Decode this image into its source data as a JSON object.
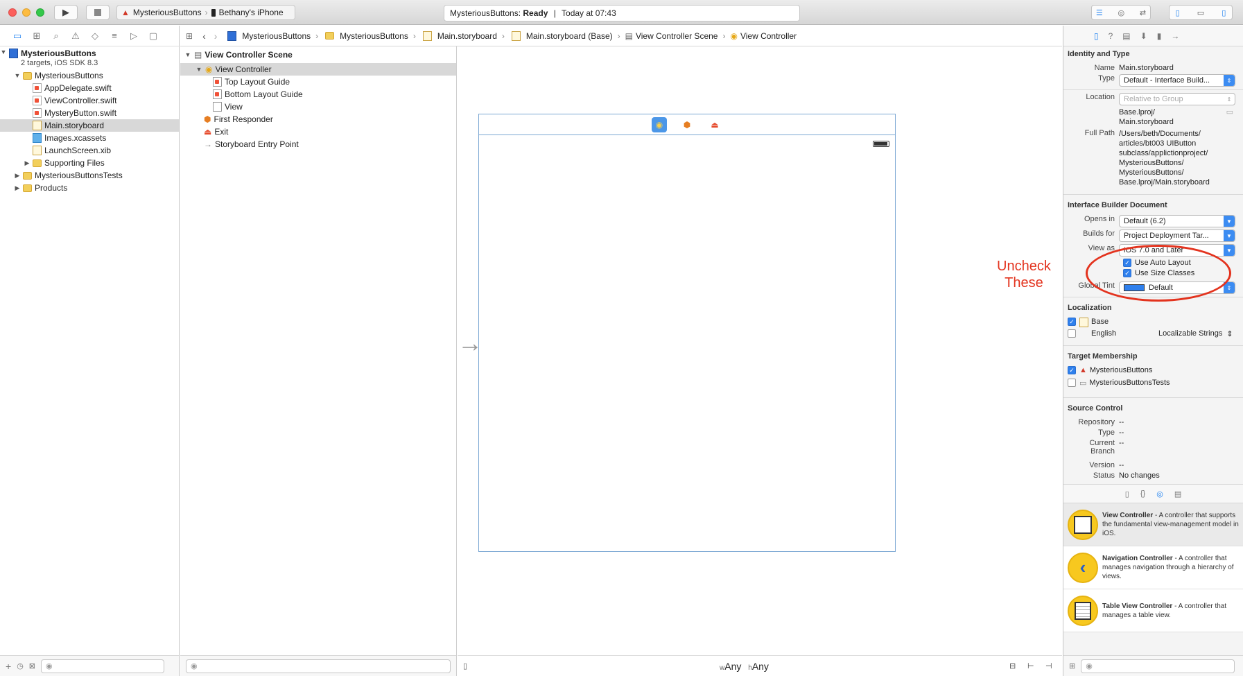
{
  "scheme": {
    "project": "MysteriousButtons",
    "device": "Bethany's iPhone"
  },
  "status": {
    "project": "MysteriousButtons:",
    "state": "Ready",
    "time": "Today at 07:43"
  },
  "navigator": {
    "project": {
      "name": "MysteriousButtons",
      "subtitle": "2 targets, iOS SDK 8.3"
    },
    "items": [
      {
        "label": "MysteriousButtons",
        "indent": 1,
        "kind": "folder",
        "open": true
      },
      {
        "label": "AppDelegate.swift",
        "indent": 2,
        "kind": "swift"
      },
      {
        "label": "ViewController.swift",
        "indent": 2,
        "kind": "swift"
      },
      {
        "label": "MysteryButton.swift",
        "indent": 2,
        "kind": "swift"
      },
      {
        "label": "Main.storyboard",
        "indent": 2,
        "kind": "sb",
        "selected": true
      },
      {
        "label": "Images.xcassets",
        "indent": 2,
        "kind": "assets"
      },
      {
        "label": "LaunchScreen.xib",
        "indent": 2,
        "kind": "sb"
      },
      {
        "label": "Supporting Files",
        "indent": 2,
        "kind": "folder",
        "closed": true
      },
      {
        "label": "MysteriousButtonsTests",
        "indent": 1,
        "kind": "folder",
        "closed": true
      },
      {
        "label": "Products",
        "indent": 1,
        "kind": "folder",
        "closed": true
      }
    ]
  },
  "jumpbar": [
    "MysteriousButtons",
    "MysteriousButtons",
    "Main.storyboard",
    "Main.storyboard (Base)",
    "View Controller Scene",
    "View Controller"
  ],
  "outline": {
    "scene": "View Controller Scene",
    "items": [
      {
        "label": "View Controller",
        "indent": 1,
        "selected": true
      },
      {
        "label": "Top Layout Guide",
        "indent": 2
      },
      {
        "label": "Bottom Layout Guide",
        "indent": 2
      },
      {
        "label": "View",
        "indent": 2
      },
      {
        "label": "First Responder",
        "indent": 1
      },
      {
        "label": "Exit",
        "indent": 1
      },
      {
        "label": "Storyboard Entry Point",
        "indent": 1
      }
    ]
  },
  "annotation": {
    "line1": "Uncheck",
    "line2": "These"
  },
  "size_class": {
    "w": "w",
    "w_val": "Any",
    "h": "h",
    "h_val": "Any"
  },
  "inspector": {
    "identity": {
      "title": "Identity and Type",
      "name_label": "Name",
      "name": "Main.storyboard",
      "type_label": "Type",
      "type": "Default - Interface Build...",
      "location_label": "Location",
      "location": "Relative to Group",
      "location_path": "Base.lproj/\nMain.storyboard",
      "fullpath_label": "Full Path",
      "fullpath": "/Users/beth/Documents/\narticles/bt003 UIButton\nsubclass/applictionproject/\nMysteriousButtons/\nMysteriousButtons/\nBase.lproj/Main.storyboard"
    },
    "ibdoc": {
      "title": "Interface Builder Document",
      "opens_label": "Opens in",
      "opens": "Default (6.2)",
      "builds_label": "Builds for",
      "builds": "Project Deployment Tar...",
      "view_label": "View as",
      "view": "iOS 7.0 and Later",
      "auto_layout": "Use Auto Layout",
      "size_classes": "Use Size Classes",
      "tint_label": "Global Tint",
      "tint": "Default"
    },
    "localization": {
      "title": "Localization",
      "base": "Base",
      "english": "English",
      "strings": "Localizable Strings"
    },
    "membership": {
      "title": "Target Membership",
      "app": "MysteriousButtons",
      "tests": "MysteriousButtonsTests"
    },
    "source_control": {
      "title": "Source Control",
      "repo_label": "Repository",
      "repo": "--",
      "type_label": "Type",
      "type": "--",
      "branch_label": "Current Branch",
      "branch": "--",
      "version_label": "Version",
      "version": "--",
      "status_label": "Status",
      "status": "No changes"
    },
    "library": [
      {
        "title": "View Controller",
        "desc": " - A controller that supports the fundamental view-management model in iOS."
      },
      {
        "title": "Navigation Controller",
        "desc": " - A controller that manages navigation through a hierarchy of views."
      },
      {
        "title": "Table View Controller",
        "desc": " - A controller that manages a table view."
      }
    ]
  },
  "colors": {
    "accent": "#1b7ff0",
    "annotation": "#e3331e",
    "folder": "#f2cf5b",
    "tint_swatch": "#2f80ed"
  }
}
